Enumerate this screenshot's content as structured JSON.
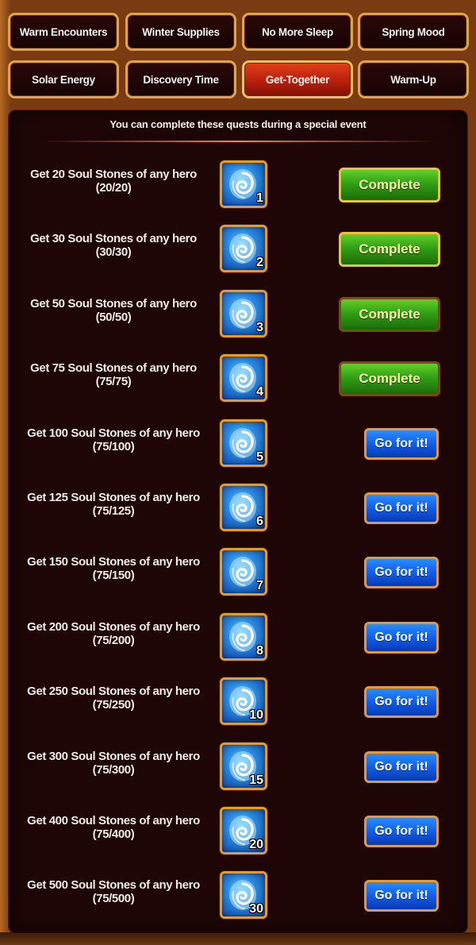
{
  "tabs": [
    {
      "label": "Warm Encounters",
      "active": false
    },
    {
      "label": "Winter Supplies",
      "active": false
    },
    {
      "label": "No More Sleep",
      "active": false
    },
    {
      "label": "Spring Mood",
      "active": false
    },
    {
      "label": "Solar Energy",
      "active": false
    },
    {
      "label": "Discovery Time",
      "active": false
    },
    {
      "label": "Get-Together",
      "active": true
    },
    {
      "label": "Warm-Up",
      "active": false
    }
  ],
  "panel": {
    "header": "You can complete these quests during a special event"
  },
  "quests": [
    {
      "title": "Get 20 Soul Stones of any hero",
      "progress": "(20/20)",
      "reward_count": "1",
      "reward_icon": "soul-stone-icon",
      "action": "Complete",
      "state": "complete"
    },
    {
      "title": "Get 30 Soul Stones of any hero",
      "progress": "(30/30)",
      "reward_count": "2",
      "reward_icon": "soul-stone-icon",
      "action": "Complete",
      "state": "complete"
    },
    {
      "title": "Get 50 Soul Stones of any hero",
      "progress": "(50/50)",
      "reward_count": "3",
      "reward_icon": "soul-stone-icon",
      "action": "Complete",
      "state": "complete"
    },
    {
      "title": "Get 75 Soul Stones of any hero",
      "progress": "(75/75)",
      "reward_count": "4",
      "reward_icon": "soul-stone-icon",
      "action": "Complete",
      "state": "complete"
    },
    {
      "title": "Get 100 Soul Stones of any hero",
      "progress": "(75/100)",
      "reward_count": "5",
      "reward_icon": "soul-stone-icon",
      "action": "Go for it!",
      "state": "go"
    },
    {
      "title": "Get 125 Soul Stones of any hero",
      "progress": "(75/125)",
      "reward_count": "6",
      "reward_icon": "soul-stone-icon",
      "action": "Go for it!",
      "state": "go"
    },
    {
      "title": "Get 150 Soul Stones of any hero",
      "progress": "(75/150)",
      "reward_count": "7",
      "reward_icon": "soul-stone-icon",
      "action": "Go for it!",
      "state": "go"
    },
    {
      "title": "Get 200 Soul Stones of any hero",
      "progress": "(75/200)",
      "reward_count": "8",
      "reward_icon": "soul-stone-icon",
      "action": "Go for it!",
      "state": "go"
    },
    {
      "title": "Get 250 Soul Stones of any hero",
      "progress": "(75/250)",
      "reward_count": "10",
      "reward_icon": "soul-stone-icon",
      "action": "Go for it!",
      "state": "go"
    },
    {
      "title": "Get 300 Soul Stones of any hero",
      "progress": "(75/300)",
      "reward_count": "15",
      "reward_icon": "soul-stone-icon",
      "action": "Go for it!",
      "state": "go"
    },
    {
      "title": "Get 400 Soul Stones of any hero",
      "progress": "(75/400)",
      "reward_count": "20",
      "reward_icon": "soul-stone-icon",
      "action": "Go for it!",
      "state": "go"
    },
    {
      "title": "Get 500 Soul Stones of any hero",
      "progress": "(75/500)",
      "reward_count": "30",
      "reward_icon": "soul-stone-icon",
      "action": "Go for it!",
      "state": "go"
    }
  ],
  "colors": {
    "panel_bg": "#1e0606",
    "tab_border": "#e0a34a",
    "tab_active": "#c8280e",
    "complete_green": "#3aa818",
    "go_blue": "#1a6cf0",
    "reward_border": "#e89a22"
  }
}
